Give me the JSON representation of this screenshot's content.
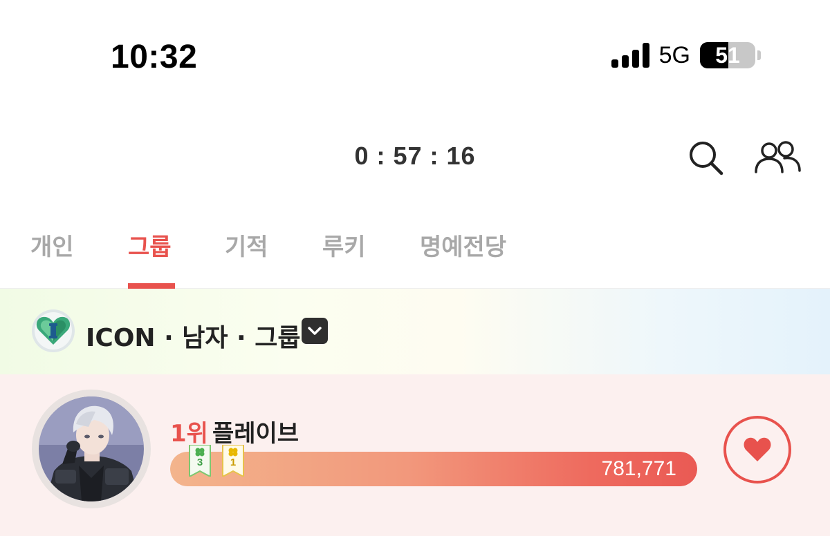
{
  "status_bar": {
    "time": "10:32",
    "network": "5G",
    "battery": "51",
    "battery_level": 0.51
  },
  "header": {
    "timer": "0 : 57 : 16",
    "icons": [
      "search-icon",
      "people-icon"
    ]
  },
  "tabs": [
    {
      "label": "개인",
      "active": false
    },
    {
      "label": "그룹",
      "active": true
    },
    {
      "label": "기적",
      "active": false
    },
    {
      "label": "루키",
      "active": false
    },
    {
      "label": "명예전당",
      "active": false
    }
  ],
  "filter": {
    "label": "ICON · 남자 · 그룹",
    "icon": "heart-gem-icon"
  },
  "ranking": [
    {
      "rank": "1위",
      "name": "플레이브",
      "votes": "781,771",
      "bar_fill_fraction": 1.0,
      "badges": [
        {
          "icon": "clover-icon",
          "count": "3",
          "color": "#4caf50"
        },
        {
          "icon": "clover-icon",
          "count": "1",
          "color": "#e8b800"
        }
      ]
    }
  ],
  "colors": {
    "accent": "#e8524d",
    "tab_inactive": "#a8a8a8",
    "row_bg": "#fcf0ef"
  }
}
